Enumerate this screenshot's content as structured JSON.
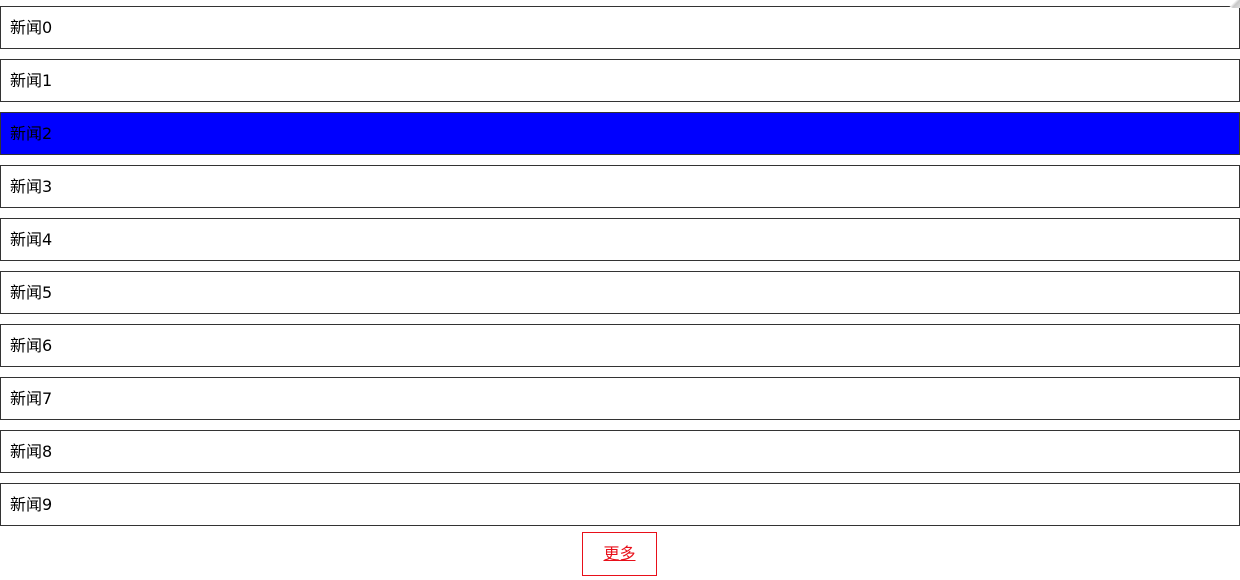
{
  "news": {
    "items": [
      {
        "label": "新闻0",
        "highlighted": false
      },
      {
        "label": "新闻1",
        "highlighted": false
      },
      {
        "label": "新闻2",
        "highlighted": true
      },
      {
        "label": "新闻3",
        "highlighted": false
      },
      {
        "label": "新闻4",
        "highlighted": false
      },
      {
        "label": "新闻5",
        "highlighted": false
      },
      {
        "label": "新闻6",
        "highlighted": false
      },
      {
        "label": "新闻7",
        "highlighted": false
      },
      {
        "label": "新闻8",
        "highlighted": false
      },
      {
        "label": "新闻9",
        "highlighted": false
      }
    ]
  },
  "more": {
    "label": "更多"
  },
  "colors": {
    "highlight_bg": "#0000ff",
    "more_accent": "#e8101a",
    "item_border": "#333333"
  }
}
